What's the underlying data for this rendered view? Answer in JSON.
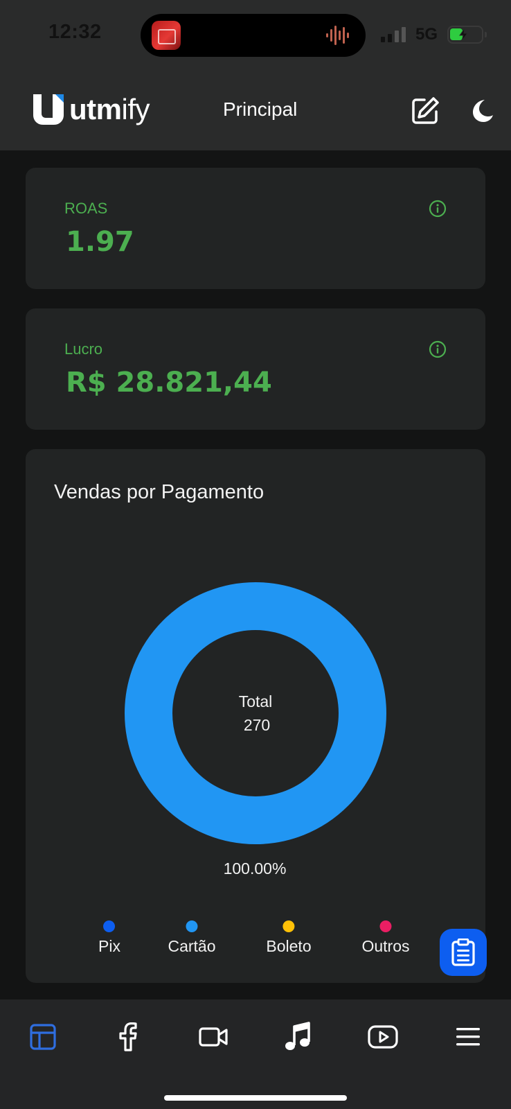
{
  "status_bar": {
    "time": "12:32",
    "network": "5G",
    "icons": [
      "signal-icon",
      "battery-charging-icon",
      "sound-wave-icon"
    ]
  },
  "header": {
    "logo_text_bold": "utm",
    "logo_text_light": "ify",
    "title": "Principal",
    "icons": [
      "edit-icon",
      "moon-icon"
    ]
  },
  "metrics": [
    {
      "label": "ROAS",
      "value": "1.97",
      "icon": "info-icon"
    },
    {
      "label": "Lucro",
      "value": "R$ 28.821,44",
      "icon": "info-icon"
    }
  ],
  "payment_card": {
    "title": "Vendas por Pagamento",
    "center_label": "Total",
    "center_value": "270",
    "percent_label": "100.00%"
  },
  "chart_data": {
    "type": "pie",
    "title": "Vendas por Pagamento",
    "categories": [
      "Pix",
      "Cartão",
      "Boleto",
      "Outros"
    ],
    "values": [
      0,
      270,
      0,
      0
    ],
    "colors": [
      "#0d5ef0",
      "#2196f3",
      "#ffc107",
      "#e91e63"
    ],
    "legend": "bottom",
    "donut": true
  },
  "legend_items": [
    {
      "label": "Pix",
      "color": "#0d5ef0"
    },
    {
      "label": "Cartão",
      "color": "#2196f3"
    },
    {
      "label": "Boleto",
      "color": "#ffc107"
    },
    {
      "label": "Outros",
      "color": "#e91e63"
    }
  ],
  "fab": {
    "icon": "clipboard-icon"
  },
  "bottom_nav": {
    "items": [
      "dashboard-icon",
      "facebook-icon",
      "video-camera-icon",
      "music-note-icon",
      "youtube-icon",
      "menu-icon"
    ]
  },
  "colors": {
    "accent": "#4caf50",
    "primary_blue": "#0d5ef0",
    "card_bg": "#222424",
    "page_bg": "#131414"
  }
}
